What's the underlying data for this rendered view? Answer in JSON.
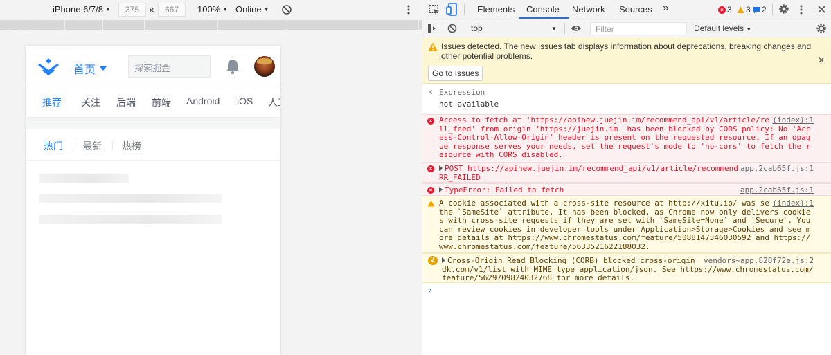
{
  "device_toolbar": {
    "device": "iPhone 6/7/8",
    "width": "375",
    "times": "×",
    "height": "667",
    "zoom": "100%",
    "network": "Online"
  },
  "app": {
    "home_label": "首页",
    "search_placeholder": "探索掘金",
    "nav_tabs": [
      "推荐",
      "关注",
      "后端",
      "前端",
      "Android",
      "iOS",
      "人工"
    ],
    "sub_tabs": [
      "热门",
      "最新",
      "热榜"
    ]
  },
  "devtools": {
    "tabs": [
      "Elements",
      "Console",
      "Network",
      "Sources"
    ],
    "more": "»",
    "error_count": "3",
    "warning_count": "3",
    "info_count": "2",
    "context": "top",
    "filter_placeholder": "Filter",
    "levels": "Default levels",
    "issues_message": "Issues detected. The new Issues tab displays information about deprecations, breaking changes and other potential problems.",
    "issues_button": "Go to Issues",
    "expression_label": "Expression",
    "expression_value": "not available",
    "logs": [
      {
        "type": "error",
        "source": "(index):1",
        "text": "Access to fetch at 'https://apinew.juejin.im/recommend_api/v1/article/recommend_all_feed' from origin 'https://juejin.im' has been blocked by CORS policy: No 'Access-Control-Allow-Origin' header is present on the requested resource. If an opaque response serves your needs, set the request's mode to 'no-cors' to fetch the resource with CORS disabled."
      },
      {
        "type": "error",
        "source": "app.2cab65f.js:1",
        "text": "POST https://apinew.juejin.im/recommend_api/v1/article/recommend_all_feed net::ERR_FAILED"
      },
      {
        "type": "error",
        "source": "app.2cab65f.js:1",
        "text": "TypeError: Failed to fetch"
      },
      {
        "type": "warning",
        "source": "(index):1",
        "text": "A cookie associated with a cross-site resource at http://xitu.io/ was set without the `SameSite` attribute. It has been blocked, as Chrome now only delivers cookies with cross-site requests if they are set with `SameSite=None` and `Secure`. You can review cookies in developer tools under Application>Storage>Cookies and see more details at https://www.chromestatus.com/feature/5088147346030592 and https://www.chromestatus.com/feature/5633521622188032."
      },
      {
        "type": "warning",
        "count": "2",
        "source": "vendors~app.828f72e.js:2",
        "text": "Cross-Origin Read Blocking (CORB) blocked cross-origin response https://mcs.snssdk.com/v1/list with MIME type application/json. See https://www.chromestatus.com/feature/5629709824032768 for more details."
      }
    ],
    "prompt": "›"
  }
}
